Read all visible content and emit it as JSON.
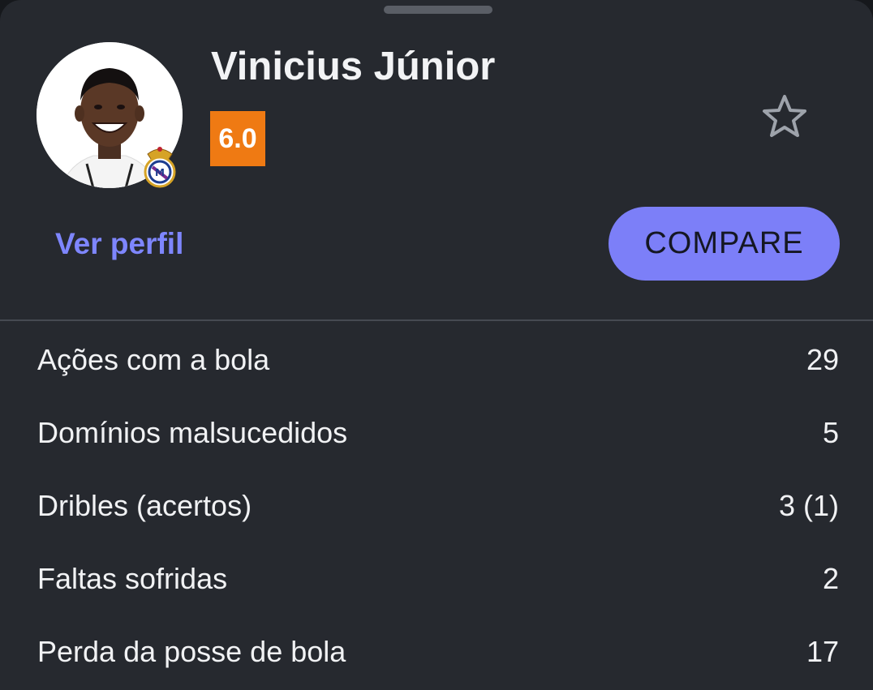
{
  "player": {
    "name": "Vinicius Júnior",
    "rating": "6.0",
    "rating_color": "#ef7a13",
    "avatar_icon": "player-photo",
    "club_icon": "real-madrid-crest"
  },
  "actions": {
    "favorite_icon": "star-outline-icon",
    "profile_link_label": "Ver perfil",
    "compare_label": "COMPARE",
    "accent_color": "#7c7ff8"
  },
  "stats": [
    {
      "label": "Ações com a bola",
      "value": "29"
    },
    {
      "label": "Domínios malsucedidos",
      "value": "5"
    },
    {
      "label": "Dribles (acertos)",
      "value": "3 (1)"
    },
    {
      "label": "Faltas sofridas",
      "value": "2"
    },
    {
      "label": "Perda da posse de bola",
      "value": "17"
    }
  ]
}
